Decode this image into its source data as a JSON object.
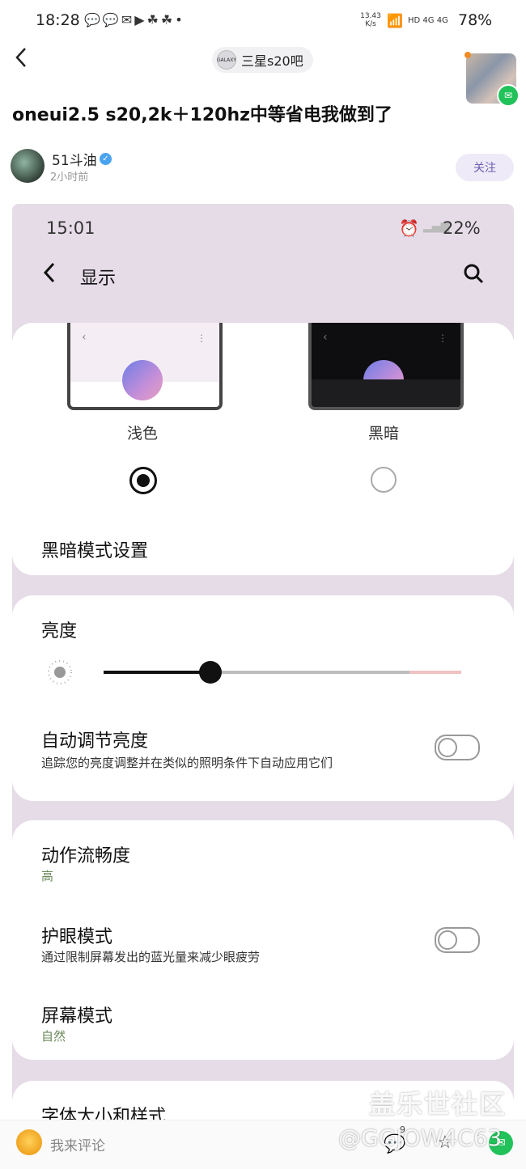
{
  "outer_status": {
    "time": "18:28",
    "net_speed": "13.43 K/s",
    "indicators": "HD 4G 4G",
    "battery": "78%"
  },
  "header": {
    "back_icon": "←",
    "forum_name": "三星s20吧",
    "forum_logo_text": "GALAXY"
  },
  "post": {
    "title": "oneui2.5 s20,2k＋120hz中等省电我做到了",
    "author": "51斗油",
    "time_ago": "2小时前",
    "follow_label": "关注"
  },
  "screenshot": {
    "status_time": "15:01",
    "status_battery": "22%",
    "page_title": "显示",
    "theme": {
      "light_label": "浅色",
      "dark_label": "黑暗",
      "selected": "light"
    },
    "dark_settings_label": "黑暗模式设置",
    "brightness": {
      "label": "亮度",
      "level": 0.3
    },
    "auto_brightness": {
      "title": "自动调节亮度",
      "subtitle": "追踪您的亮度调整并在类似的照明条件下自动应用它们",
      "enabled": false
    },
    "motion": {
      "title": "动作流畅度",
      "value": "高"
    },
    "eye_comfort": {
      "title": "护眼模式",
      "subtitle": "通过限制屏幕发出的蓝光量来减少眼疲劳",
      "enabled": false
    },
    "screen_mode": {
      "title": "屏幕模式",
      "value": "自然"
    },
    "font_row": "字体大小和样式"
  },
  "comment_bar": {
    "placeholder": "我来评论",
    "like_count": "9"
  },
  "watermark": {
    "line1": "盖乐世社区",
    "line2": "@GGJOW4C63"
  },
  "colors": {
    "accent": "#6a5fb0",
    "embed_bg": "#e6dce8",
    "accent_green": "#6b8a5a"
  }
}
